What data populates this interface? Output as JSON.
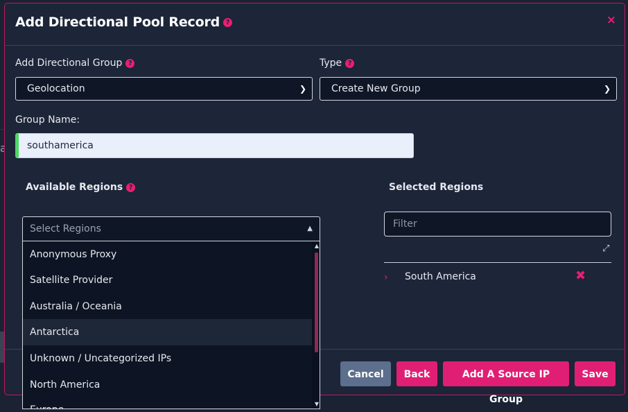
{
  "modal": {
    "title": "Add Directional Pool Record",
    "help": "?",
    "close": "×"
  },
  "form": {
    "directional_group_label": "Add Directional Group",
    "directional_group_value": "Geolocation",
    "type_label": "Type",
    "type_value": "Create New Group",
    "group_name_label": "Group Name:",
    "group_name_value": "southamerica"
  },
  "regions": {
    "available_label": "Available Regions",
    "selected_label": "Selected Regions",
    "select_placeholder": "Select Regions",
    "filter_placeholder": "Filter",
    "options": [
      "Anonymous Proxy",
      "Satellite Provider",
      "Australia / Oceania",
      "Antarctica",
      "Unknown / Uncategorized IPs",
      "North America",
      "Europe"
    ],
    "highlighted_option": "Antarctica",
    "selected": [
      "South America"
    ]
  },
  "buttons": {
    "cancel": "Cancel",
    "back": "Back",
    "add_source_ip": "Add A Source IP Group",
    "save": "Save"
  },
  "backdrop": {
    "partial_char": "a"
  },
  "colors": {
    "accent": "#e01f74",
    "modal_bg": "#1d2538",
    "success": "#4cd964"
  }
}
